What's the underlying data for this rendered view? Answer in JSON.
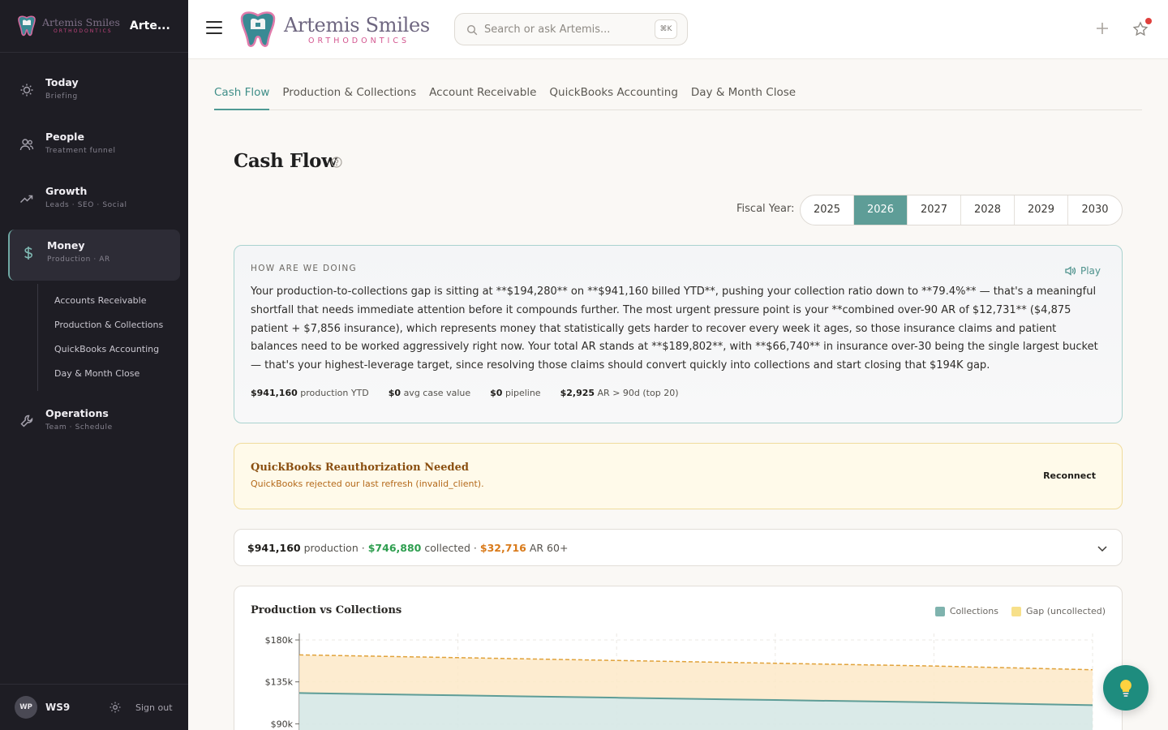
{
  "sidebar": {
    "brand": {
      "name": "Artemis Smiles",
      "sub": "ORTHODONTICS",
      "short": "Arte..."
    },
    "items": [
      {
        "title": "Today",
        "sub": "Briefing",
        "icon": "sun-icon"
      },
      {
        "title": "People",
        "sub": "Treatment funnel",
        "icon": "people-icon"
      },
      {
        "title": "Growth",
        "sub": "Leads · SEO · Social",
        "icon": "trend-up-icon"
      },
      {
        "title": "Money",
        "sub": "Production · AR",
        "icon": "dollar-icon",
        "active": true
      },
      {
        "title": "Operations",
        "sub": "Team · Schedule",
        "icon": "wrench-icon"
      }
    ],
    "money_children": [
      "Accounts Receivable",
      "Production & Collections",
      "QuickBooks Accounting",
      "Day & Month Close"
    ],
    "footer": {
      "initials": "WP",
      "user": "WS9",
      "signout": "Sign out"
    }
  },
  "topbar": {
    "brand_name": "Artemis Smiles",
    "brand_sub": "ORTHODONTICS",
    "search_placeholder": "Search or ask Artemis...",
    "search_shortcut": "⌘K"
  },
  "tabs": [
    "Cash Flow",
    "Production & Collections",
    "Account Receivable",
    "QuickBooks Accounting",
    "Day & Month Close"
  ],
  "active_tab": "Cash Flow",
  "page_title": "Cash Flow",
  "fiscal_year": {
    "label": "Fiscal Year:",
    "years": [
      "2025",
      "2026",
      "2027",
      "2028",
      "2029",
      "2030"
    ],
    "selected": "2026"
  },
  "briefing": {
    "heading": "HOW ARE WE DOING",
    "play_label": "Play",
    "text": "Your production-to-collections gap is sitting at **$194,280** on **$941,160 billed YTD**, pushing your collection ratio down to **79.4%** — that's a meaningful shortfall that needs immediate attention before it compounds further. The most urgent pressure point is your **combined over-90 AR of $12,731** ($4,875 patient + $7,856 insurance), which represents money that statistically gets harder to recover every week it ages, so those insurance claims and patient balances need to be worked aggressively right now. Your total AR stands at **$189,802**, with **$66,740** in insurance over-30 being the single largest bucket — that's your highest-leverage target, since resolving those claims should convert quickly into collections and start closing that $194K gap.",
    "stats": [
      {
        "value": "$941,160",
        "label": "production YTD"
      },
      {
        "value": "$0",
        "label": "avg case value"
      },
      {
        "value": "$0",
        "label": "pipeline"
      },
      {
        "value": "$2,925",
        "label": "AR > 90d (top 20)"
      }
    ]
  },
  "qb_alert": {
    "title": "QuickBooks Reauthorization Needed",
    "message": "QuickBooks rejected our last refresh (invalid_client).",
    "button": "Reconnect"
  },
  "summary": {
    "production": "$941,160",
    "production_label": "production",
    "collected": "$746,880",
    "collected_label": "collected",
    "ar60": "$32,716",
    "ar60_label": "AR 60+",
    "sep": "·"
  },
  "chart": {
    "title": "Production vs Collections",
    "legend": [
      {
        "name": "Collections",
        "color": "#7fb3ae"
      },
      {
        "name": "Gap (uncollected)",
        "color": "#f7e08a"
      }
    ]
  },
  "chart_data": {
    "type": "area",
    "title": "Production vs Collections",
    "y_ticks": [
      "$180k",
      "$135k",
      "$90k"
    ],
    "y_tick_values": [
      180000,
      135000,
      90000
    ],
    "ylim": [
      60000,
      180000
    ],
    "x": [
      0,
      1,
      2,
      3,
      4,
      5
    ],
    "series": [
      {
        "name": "Collections",
        "values": [
          123000,
          120500,
          118000,
          115500,
          113000,
          110000
        ]
      },
      {
        "name": "Gap (uncollected)",
        "values": [
          41000,
          40500,
          40000,
          39500,
          39000,
          38000
        ]
      }
    ],
    "grid": true
  },
  "colors": {
    "accent": "#5e9d97",
    "sidebar_bg": "#1e1d24",
    "fab": "#1e8c7e"
  }
}
